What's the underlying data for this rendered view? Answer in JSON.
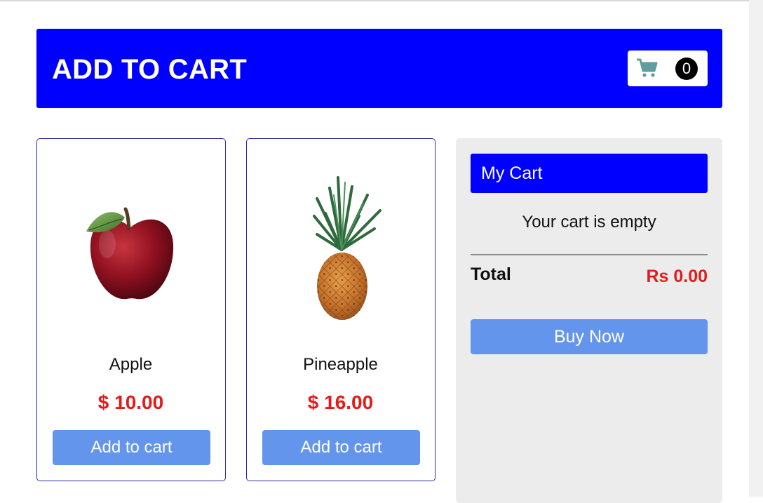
{
  "header": {
    "title": "ADD TO CART",
    "cart_icon": "shopping-cart-icon",
    "cart_count": "0"
  },
  "products": [
    {
      "name": "Apple",
      "price": "$ 10.00",
      "button_label": "Add to cart",
      "image": "apple-image"
    },
    {
      "name": "Pineapple",
      "price": "$ 16.00",
      "button_label": "Add to cart",
      "image": "pineapple-image"
    }
  ],
  "cart": {
    "title": "My Cart",
    "empty_message": "Your cart is empty",
    "total_label": "Total",
    "total_value": "Rs 0.00",
    "buy_label": "Buy Now"
  },
  "colors": {
    "primary": "#0000ff",
    "button": "#6495ed",
    "price": "#e31b1b",
    "cart_icon": "#5f9ea0"
  }
}
